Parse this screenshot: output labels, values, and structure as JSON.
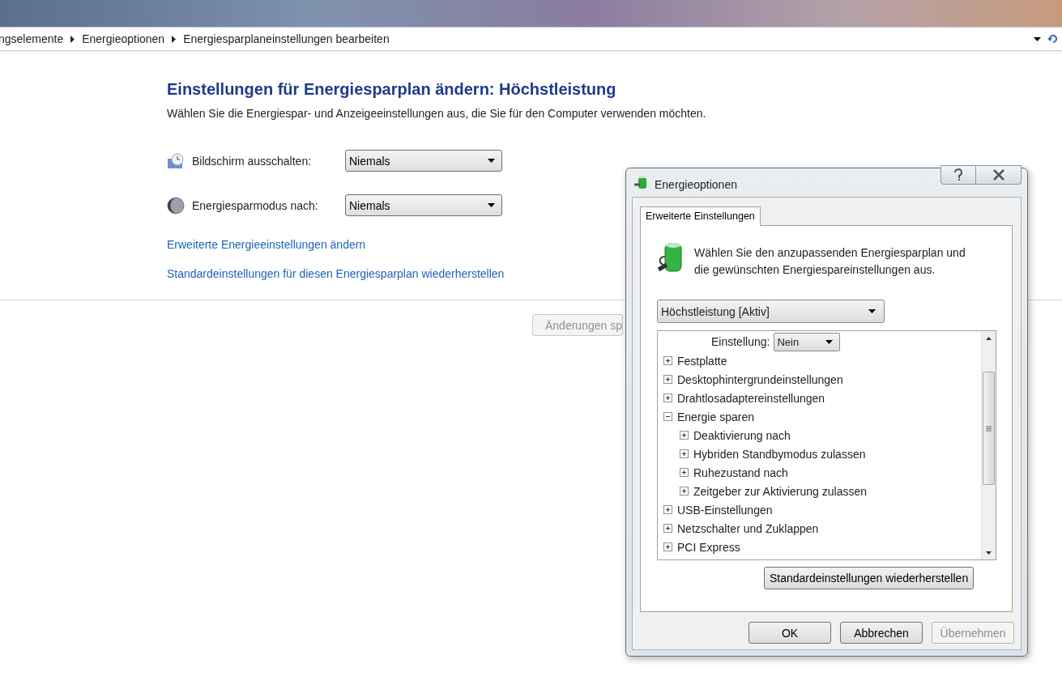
{
  "address_bar": {
    "breadcrumbs": [
      "ngselemente",
      "Energieoptionen",
      "Energiesparplaneinstellungen bearbeiten"
    ]
  },
  "page": {
    "title": "Einstellungen für Energiesparplan ändern: Höchstleistung",
    "subtitle": "Wählen Sie die Energiespar- und Anzeigeeinstellungen aus, die Sie für den Computer verwenden möchten.",
    "settings": [
      {
        "kind": "display",
        "label": "Bildschirm ausschalten:",
        "value": "Niemals"
      },
      {
        "kind": "sleep",
        "label": "Energiesparmodus nach:",
        "value": "Niemals"
      }
    ],
    "links": [
      "Erweiterte Energieeinstellungen ändern",
      "Standardeinstellungen für diesen Energiesparplan wiederherstellen"
    ],
    "save_button": {
      "label": "Änderungen sp",
      "disabled": true
    }
  },
  "dialog": {
    "title": "Energieoptionen",
    "tabs": [
      {
        "label": "Erweiterte Einstellungen",
        "selected": true
      }
    ],
    "description": "Wählen Sie den anzupassenden Energiesparplan und die gewünschten Energiespareinstellungen aus.",
    "plan_select": "Höchstleistung [Aktiv]",
    "setting_row": {
      "label": "Einstellung:",
      "value": "Nein"
    },
    "tree": [
      {
        "label": "Festplatte",
        "expanded": false
      },
      {
        "label": "Desktophintergrundeinstellungen",
        "expanded": false
      },
      {
        "label": "Drahtlosadaptereinstellungen",
        "expanded": false
      },
      {
        "label": "Energie sparen",
        "expanded": true,
        "children": [
          {
            "label": "Deaktivierung nach",
            "expanded": false
          },
          {
            "label": "Hybriden Standbymodus zulassen",
            "expanded": false
          },
          {
            "label": "Ruhezustand nach",
            "expanded": false
          },
          {
            "label": "Zeitgeber zur Aktivierung zulassen",
            "expanded": false
          }
        ]
      },
      {
        "label": "USB-Einstellungen",
        "expanded": false
      },
      {
        "label": "Netzschalter und Zuklappen",
        "expanded": false
      },
      {
        "label": "PCI Express",
        "expanded": false
      }
    ],
    "restore_button": "Standardeinstellungen wiederherstellen",
    "buttons": [
      {
        "label": "OK",
        "disabled": false
      },
      {
        "label": "Abbrechen",
        "disabled": false
      },
      {
        "label": "Übernehmen",
        "disabled": true
      }
    ]
  }
}
